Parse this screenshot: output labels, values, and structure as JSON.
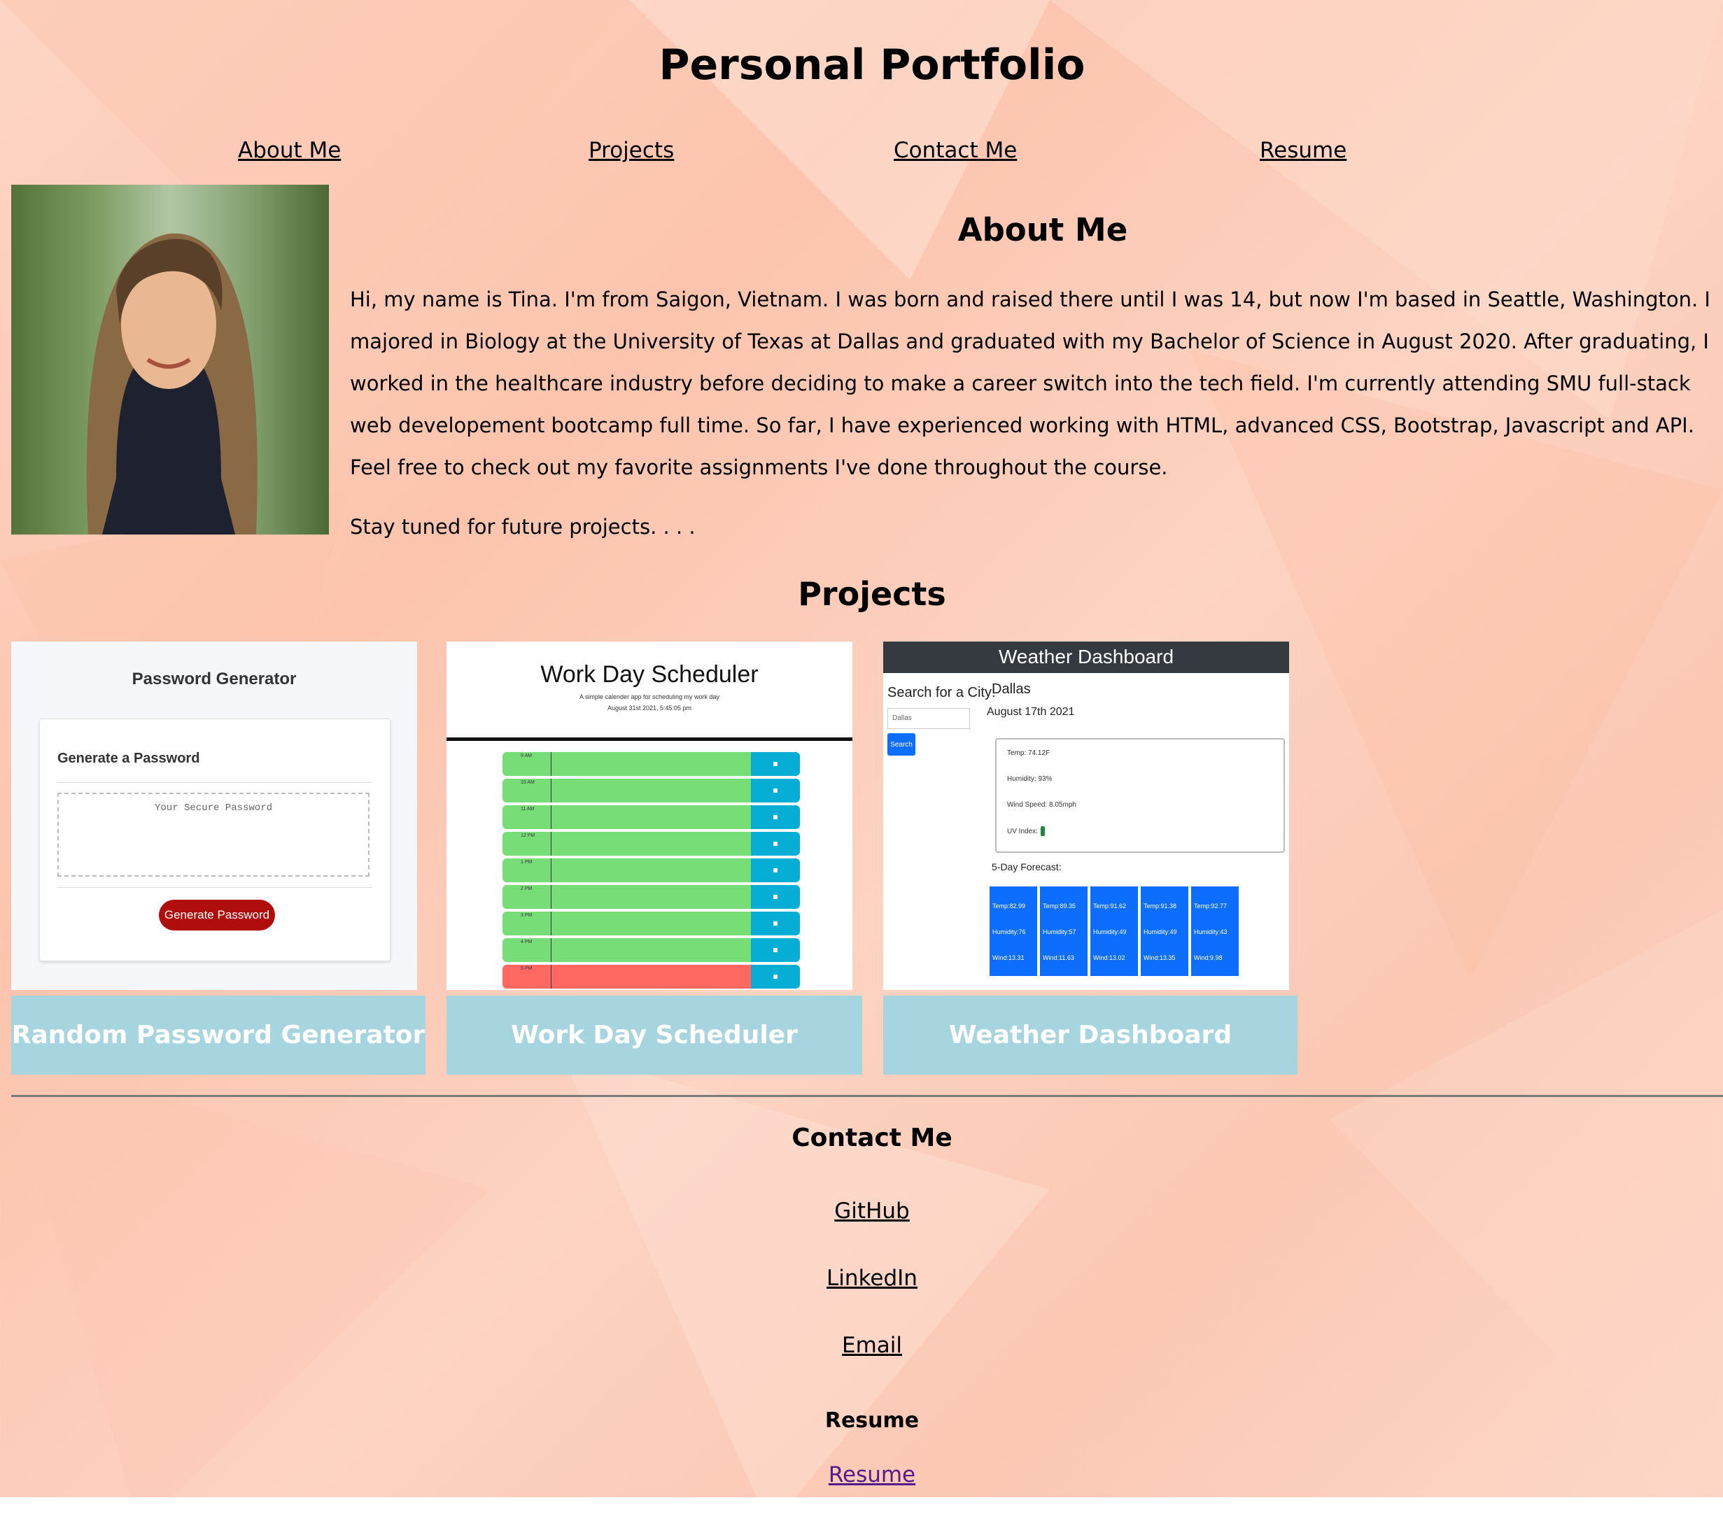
{
  "header": {
    "title": "Personal Portfolio"
  },
  "nav": [
    {
      "label": "About Me"
    },
    {
      "label": "Projects"
    },
    {
      "label": "Contact Me"
    },
    {
      "label": "Resume"
    }
  ],
  "about": {
    "heading": "About Me",
    "paragraph": "Hi, my name is Tina. I'm from Saigon, Vietnam. I was born and raised there until I was 14, but now I'm based in Seattle, Washington. I majored in Biology at the University of Texas at Dallas and graduated with my Bachelor of Science in August 2020. After graduating, I worked in the healthcare industry before deciding to make a career switch into the tech field. I'm currently attending SMU full-stack web developement bootcamp full time. So far, I have experienced working with HTML, advanced CSS, Bootstrap, Javascript and API. Feel free to check out my favorite assignments I've done throughout the course.",
    "tagline": "Stay tuned for future projects. . . ."
  },
  "projects": {
    "heading": "Projects",
    "items": [
      {
        "label": "Random Password Generator",
        "preview": {
          "title": "Password Generator",
          "card_title": "Generate a Password",
          "placeholder": "Your Secure Password",
          "button": "Generate Password"
        }
      },
      {
        "label": "Work Day Scheduler",
        "preview": {
          "title": "Work Day Scheduler",
          "subtitle": "A simple calender app for scheduling my work day",
          "date": "August 31st 2021, 5:45:05 pm",
          "hours": [
            "9 AM",
            "10 AM",
            "11 AM",
            "12 PM",
            "1 PM",
            "2 PM",
            "3 PM",
            "4 PM",
            "5 PM"
          ]
        }
      },
      {
        "label": "Weather Dashboard",
        "preview": {
          "title": "Weather Dashboard",
          "search_label": "Search for a City:",
          "search_value": "Dallas",
          "search_button": "Search",
          "city": "Dallas",
          "date": "August 17th 2021",
          "temp": "Temp: 74.12F",
          "humidity": "Humidity: 93%",
          "wind": "Wind Speed: 8.05mph",
          "uv": "UV Index:",
          "forecast_label": "5-Day Forecast:",
          "forecast": [
            {
              "temp": "Temp:82.99",
              "humidity": "Humidity:76",
              "wind": "Wind:13.31"
            },
            {
              "temp": "Temp:89.35",
              "humidity": "Humidity:57",
              "wind": "Wind:11.63"
            },
            {
              "temp": "Temp:91.62",
              "humidity": "Humidity:49",
              "wind": "Wind:13.02"
            },
            {
              "temp": "Temp:91.38",
              "humidity": "Humidity:49",
              "wind": "Wind:13.35"
            },
            {
              "temp": "Temp:92.77",
              "humidity": "Humidity:43",
              "wind": "Wind:9.98"
            }
          ]
        }
      }
    ]
  },
  "contact": {
    "heading": "Contact Me",
    "links": [
      {
        "label": "GitHub"
      },
      {
        "label": "LinkedIn"
      },
      {
        "label": "Email"
      }
    ]
  },
  "resume": {
    "heading": "Resume",
    "link": "Resume"
  },
  "colors": {
    "card_label_bg": "#a6d5df",
    "scheduler_green": "#77dd77",
    "scheduler_red": "#ff6961",
    "scheduler_save": "#06aed5",
    "weather_blue": "#0d6efd",
    "password_button": "#b00d0d",
    "visited_link": "#551a8b"
  }
}
